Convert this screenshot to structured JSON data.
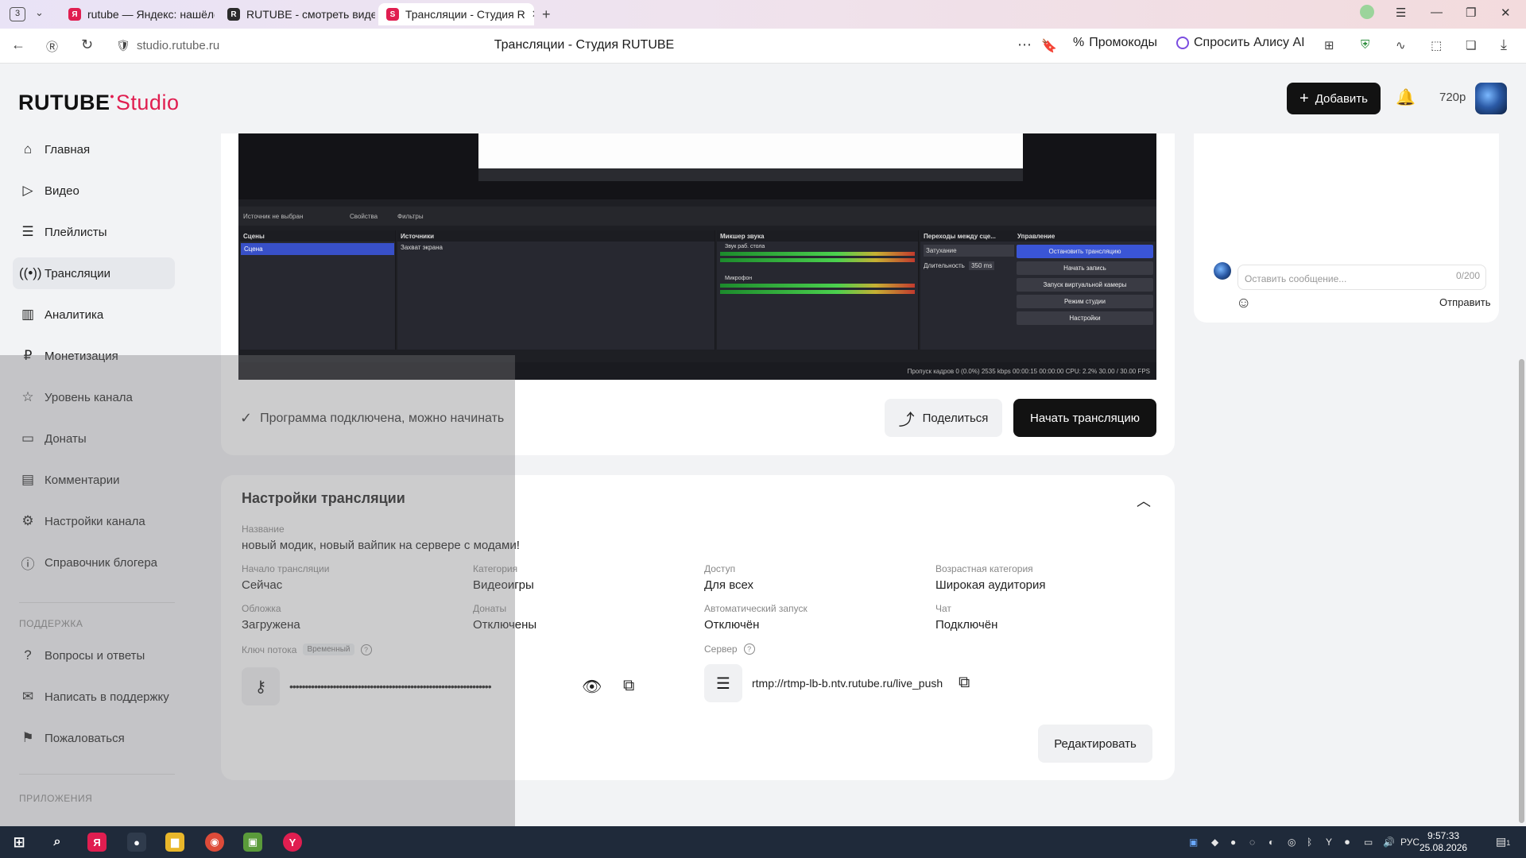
{
  "browser": {
    "tab_count": "3",
    "tabs": [
      {
        "label": "rutube — Яндекс: нашёлс",
        "fav": "Я",
        "color": "#e01e50"
      },
      {
        "label": "RUTUBE - смотреть виде",
        "fav": "R",
        "color": "#2b2b2b"
      },
      {
        "label": "Трансляции - Студия R",
        "fav": "S",
        "color": "#e01e50"
      }
    ],
    "url": "studio.rutube.ru",
    "page_title": "Трансляции - Студия RUTUBE",
    "promo_label": "Промокоды",
    "alice_label": "Спросить Алису AI"
  },
  "header": {
    "logo_text": "RUTUBE",
    "logo_studio": "Studio",
    "add_label": "Добавить",
    "quality": "720p"
  },
  "sidebar": {
    "items": [
      {
        "label": "Главная",
        "icon": "home-icon"
      },
      {
        "label": "Видео",
        "icon": "video-icon"
      },
      {
        "label": "Плейлисты",
        "icon": "playlist-icon"
      },
      {
        "label": "Трансляции",
        "icon": "broadcast-icon"
      },
      {
        "label": "Аналитика",
        "icon": "analytics-icon"
      },
      {
        "label": "Монетизация",
        "icon": "monetization-icon"
      },
      {
        "label": "Уровень канала",
        "icon": "star-icon"
      },
      {
        "label": "Донаты",
        "icon": "donate-icon"
      },
      {
        "label": "Комментарии",
        "icon": "comments-icon"
      },
      {
        "label": "Настройки канала",
        "icon": "gear-icon"
      },
      {
        "label": "Справочник блогера",
        "icon": "info-icon"
      }
    ],
    "support_heading": "ПОДДЕРЖКА",
    "support_items": [
      {
        "label": "Вопросы и ответы",
        "icon": "question-icon"
      },
      {
        "label": "Написать в поддержку",
        "icon": "mail-icon"
      },
      {
        "label": "Пожаловаться",
        "icon": "flag-icon"
      }
    ],
    "apps_heading": "ПРИЛОЖЕНИЯ"
  },
  "obs": {
    "source_none": "Источник не выбран",
    "props": "Свойства",
    "filters": "Фильтры",
    "scenes_header": "Сцены",
    "scene_item": "Сцена",
    "sources_header": "Источники",
    "source_item": "Захват экрана",
    "mixer_header": "Микшер звука",
    "mixer_ch1": "Звук раб. стола",
    "mixer_ch2": "Микрофон",
    "transitions_header": "Переходы между сце...",
    "transition_value": "Затухание",
    "duration_label": "Длительность",
    "duration_value": "350 ms",
    "controls_header": "Управление",
    "controls": [
      "Остановить трансляцию",
      "Начать запись",
      "Запуск виртуальной камеры",
      "Режим студии",
      "Настройки"
    ],
    "status": "Пропуск кадров 0 (0.0%)   2535 kbps   00:00:15   00:00:00   CPU: 2.2%   30.00 / 30.00 FPS"
  },
  "stream": {
    "connected_text": "Программа подключена, можно начинать",
    "share_label": "Поделиться",
    "start_label": "Начать трансляцию"
  },
  "settings": {
    "title": "Настройки трансляции",
    "name_label": "Название",
    "name_value": "новый модик, новый вайпик на сервере с модами!",
    "start_label": "Начало трансляции",
    "start_value": "Сейчас",
    "category_label": "Категория",
    "category_value": "Видеоигры",
    "access_label": "Доступ",
    "access_value": "Для всех",
    "age_label": "Возрастная категория",
    "age_value": "Широкая аудитория",
    "cover_label": "Обложка",
    "cover_value": "Загружена",
    "donations_label": "Донаты",
    "donations_value": "Отключены",
    "autostart_label": "Автоматический запуск",
    "autostart_value": "Отключён",
    "chat_label": "Чат",
    "chat_value": "Подключён",
    "key_label": "Ключ потока",
    "key_badge": "Временный",
    "key_value": "•••••••••••••••••••••••••••••••••••••••••••••••••••••••••••••••••",
    "server_label": "Сервер",
    "server_value": "rtmp://rtmp-lb-b.ntv.rutube.ru/live_push",
    "edit_label": "Редактировать"
  },
  "chat": {
    "placeholder": "Оставить сообщение...",
    "counter": "0/200",
    "send_label": "Отправить"
  },
  "taskbar": {
    "lang": "РУС",
    "time": "9:57:33",
    "date": "25.08.2026",
    "notif_count": "1"
  }
}
